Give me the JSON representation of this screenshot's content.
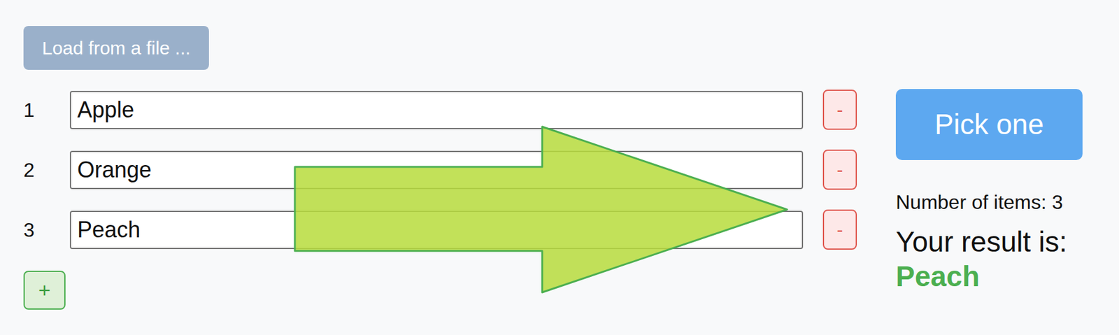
{
  "load_button": {
    "label": "Load from a file ..."
  },
  "items": [
    {
      "index": "1",
      "value": "Apple",
      "remove_label": "-"
    },
    {
      "index": "2",
      "value": "Orange",
      "remove_label": "-"
    },
    {
      "index": "3",
      "value": "Peach",
      "remove_label": "-"
    }
  ],
  "add_button": {
    "label": "+"
  },
  "pick_button": {
    "label": "Pick one"
  },
  "count_text": "Number of items: 3",
  "result": {
    "label": "Your result is:",
    "value": "Peach"
  }
}
